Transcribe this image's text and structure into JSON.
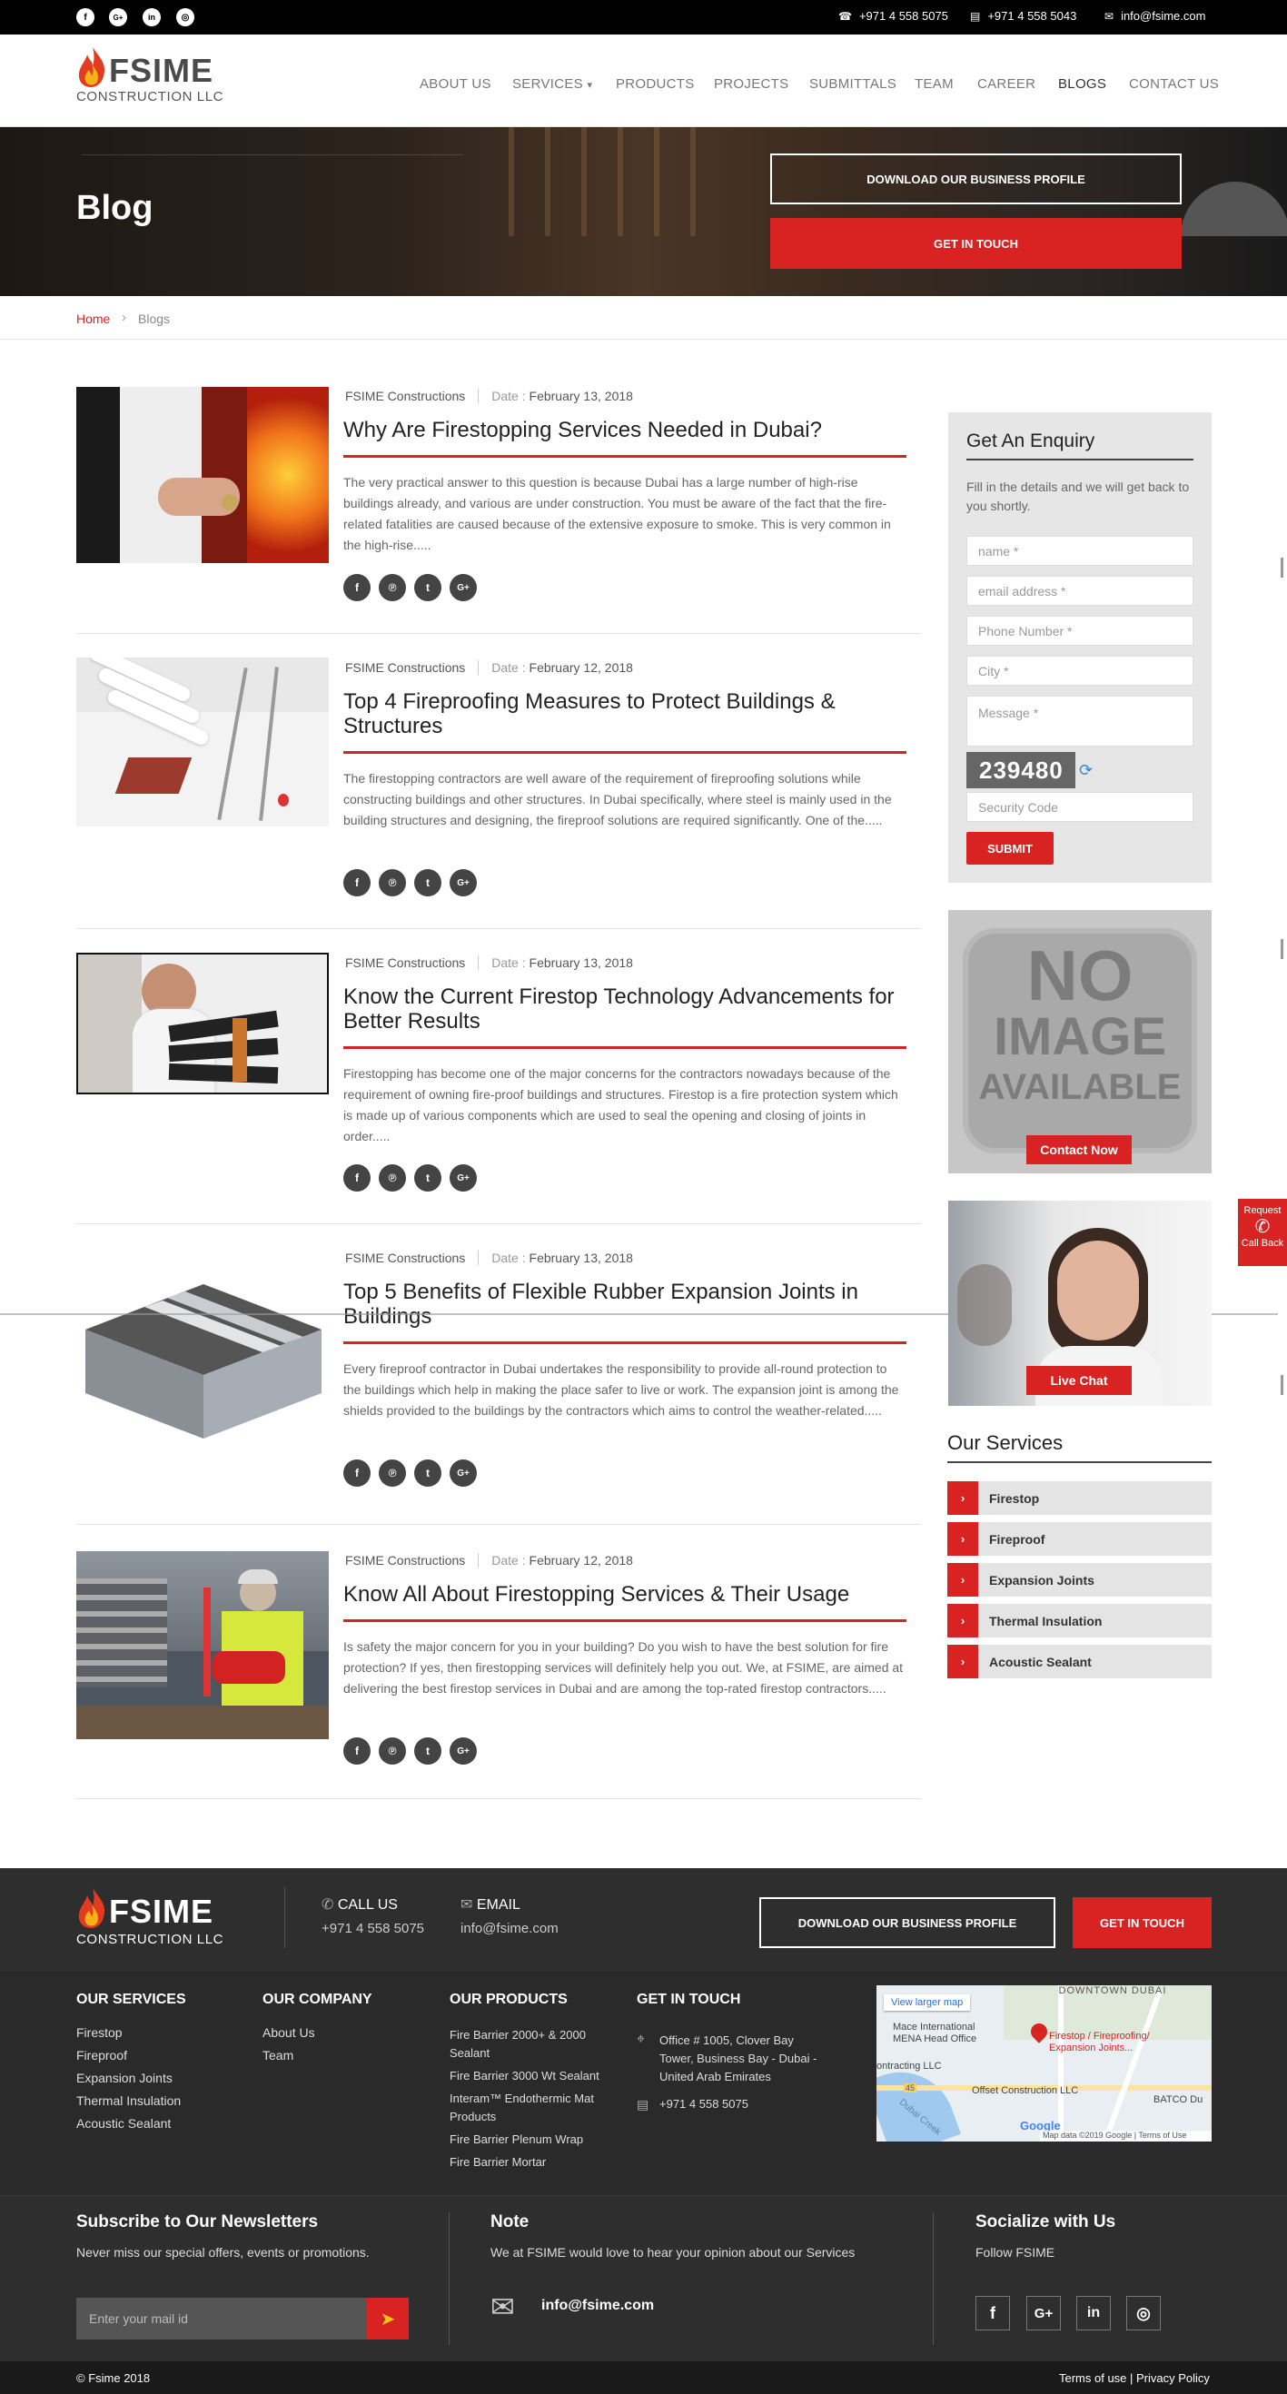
{
  "topbar": {
    "phone1": "+971 4 558 5075",
    "phone2": "+971 4 558 5043",
    "email": "info@fsime.com",
    "social": [
      "f",
      "G+",
      "in",
      "◎"
    ]
  },
  "brand": {
    "name": "FSIME",
    "sub": "CONSTRUCTION LLC",
    "accent": "#d92323"
  },
  "nav": {
    "items": [
      "ABOUT US",
      "SERVICES",
      "PRODUCTS",
      "PROJECTS",
      "SUBMITTALS",
      "TEAM",
      "CAREER",
      "BLOGS",
      "CONTACT US"
    ],
    "caret": "▾"
  },
  "hero": {
    "title": "Blog",
    "download": "DOWNLOAD OUR BUSINESS PROFILE",
    "touch": "GET IN TOUCH"
  },
  "breadcrumb": {
    "home": "Home",
    "sep": "›",
    "current": "Blogs"
  },
  "posts": [
    {
      "author": "FSIME Constructions",
      "date_label": "Date :",
      "date": "February 13, 2018",
      "title": "Why Are Firestopping Services Needed in Dubai?",
      "excerpt": "The very practical answer to this question is because Dubai has a large number of high-rise buildings already, and various are under construction. You must be aware of the fact that the fire-related fatalities are caused because of the extensive exposure to smoke. This is very common in the high-rise....."
    },
    {
      "author": "FSIME Constructions",
      "date_label": "Date :",
      "date": "February 12, 2018",
      "title": "Top 4 Fireproofing Measures to Protect Buildings & Structures",
      "excerpt": "The firestopping contractors are well aware of the requirement of fireproofing solutions while constructing buildings and other structures. In Dubai specifically, where steel is mainly used in the building structures and designing, the fireproof solutions are required significantly. One of the....."
    },
    {
      "author": "FSIME Constructions",
      "date_label": "Date :",
      "date": "February 13, 2018",
      "title": "Know the Current Firestop Technology Advancements for Better Results",
      "excerpt": "Firestopping has become one of the major concerns for the contractors nowadays because of the requirement of owning fire-proof buildings and structures. Firestop is a fire protection system which is made up of various components which are used to seal the opening and closing of joints in order....."
    },
    {
      "author": "FSIME Constructions",
      "date_label": "Date :",
      "date": "February 13, 2018",
      "title": "Top 5 Benefits of Flexible Rubber Expansion Joints in Buildings",
      "excerpt": "Every fireproof contractor in Dubai undertakes the responsibility to provide all-round protection to the buildings which help in making the place safer to live or work. The expansion joint is among the shields provided to the buildings by the contractors which aims to control the weather-related....."
    },
    {
      "author": "FSIME Constructions",
      "date_label": "Date :",
      "date": "February 12, 2018",
      "title": "Know All About Firestopping Services & Their Usage",
      "excerpt": "Is safety the major concern for you in your building? Do you wish to have the best solution for fire protection? If yes, then firestopping services will definitely help you out. We, at FSIME, are aimed at delivering the best firestop services in Dubai and are among the top-rated firestop contractors....."
    }
  ],
  "share": [
    "f",
    "℗",
    "t",
    "G+"
  ],
  "enquiry": {
    "title": "Get An Enquiry",
    "intro": "Fill in the details and we will get back to you shortly.",
    "name": "name *",
    "email": "email address *",
    "phone": "Phone Number *",
    "city": "City *",
    "message": "Message *",
    "captcha": "239480",
    "security": "Security Code",
    "submit": "SUBMIT"
  },
  "noimage": {
    "line1": "NO",
    "line2": "IMAGE",
    "line3": "AVAILABLE",
    "button": "Contact Now"
  },
  "livechat": {
    "button": "Live Chat"
  },
  "callback": {
    "line1": "Request",
    "line2": "Call Back"
  },
  "services": {
    "title": "Our Services",
    "items": [
      "Firestop",
      "Fireproof",
      "Expansion Joints",
      "Thermal Insulation",
      "Acoustic Sealant"
    ]
  },
  "footer": {
    "call_label": "CALL US",
    "call": "+971 4 558 5075",
    "email_label": "EMAIL",
    "email": "info@fsime.com",
    "download": "DOWNLOAD OUR BUSINESS PROFILE",
    "touch": "GET IN TOUCH",
    "col1": {
      "title": "OUR SERVICES",
      "items": [
        "Firestop",
        "Fireproof",
        "Expansion Joints",
        "Thermal Insulation",
        "Acoustic Sealant"
      ]
    },
    "col2": {
      "title": "OUR COMPANY",
      "items": [
        "About Us",
        "Team"
      ]
    },
    "col3": {
      "title": "OUR PRODUCTS",
      "items": [
        "Fire Barrier 2000+ & 2000 Sealant",
        "Fire Barrier 3000 Wt Sealant",
        "Interam™ Endothermic Mat Products",
        "Fire Barrier Plenum Wrap",
        "Fire Barrier Mortar"
      ]
    },
    "col4": {
      "title": "GET IN TOUCH",
      "address": "Office # 1005, Clover Bay Tower, Business Bay - Dubai - United Arab Emirates",
      "phone": "+971 4 558 5075"
    },
    "map": {
      "larger": "View larger map",
      "downtown": "DOWNTOWN DUBAI",
      "mace": "Mace International MENA Head Office",
      "pin": "Firestop / Fireproofing/ Expansion Joints...",
      "contracting": "ontracting LLC",
      "offset": "Offset Construction LLC",
      "batco": "BATCO Du",
      "road": "45",
      "creek": "Dubai Creek",
      "google": "Google",
      "mapdata": "Map data ©2019 Google",
      "terms": "Terms of Use"
    },
    "newsletter": {
      "title": "Subscribe to Our Newsletters",
      "text": "Never miss our special offers, events or promotions.",
      "placeholder": "Enter your mail id"
    },
    "note": {
      "title": "Note",
      "text": "We at FSIME would love to hear your opinion about our Services",
      "email": "info@fsime.com"
    },
    "socialize": {
      "title": "Socialize with Us",
      "text": "Follow FSIME",
      "icons": [
        "f",
        "G+",
        "in",
        "◎"
      ]
    },
    "copyright": "© Fsime 2018",
    "terms": "Terms of use | Privacy Policy"
  }
}
